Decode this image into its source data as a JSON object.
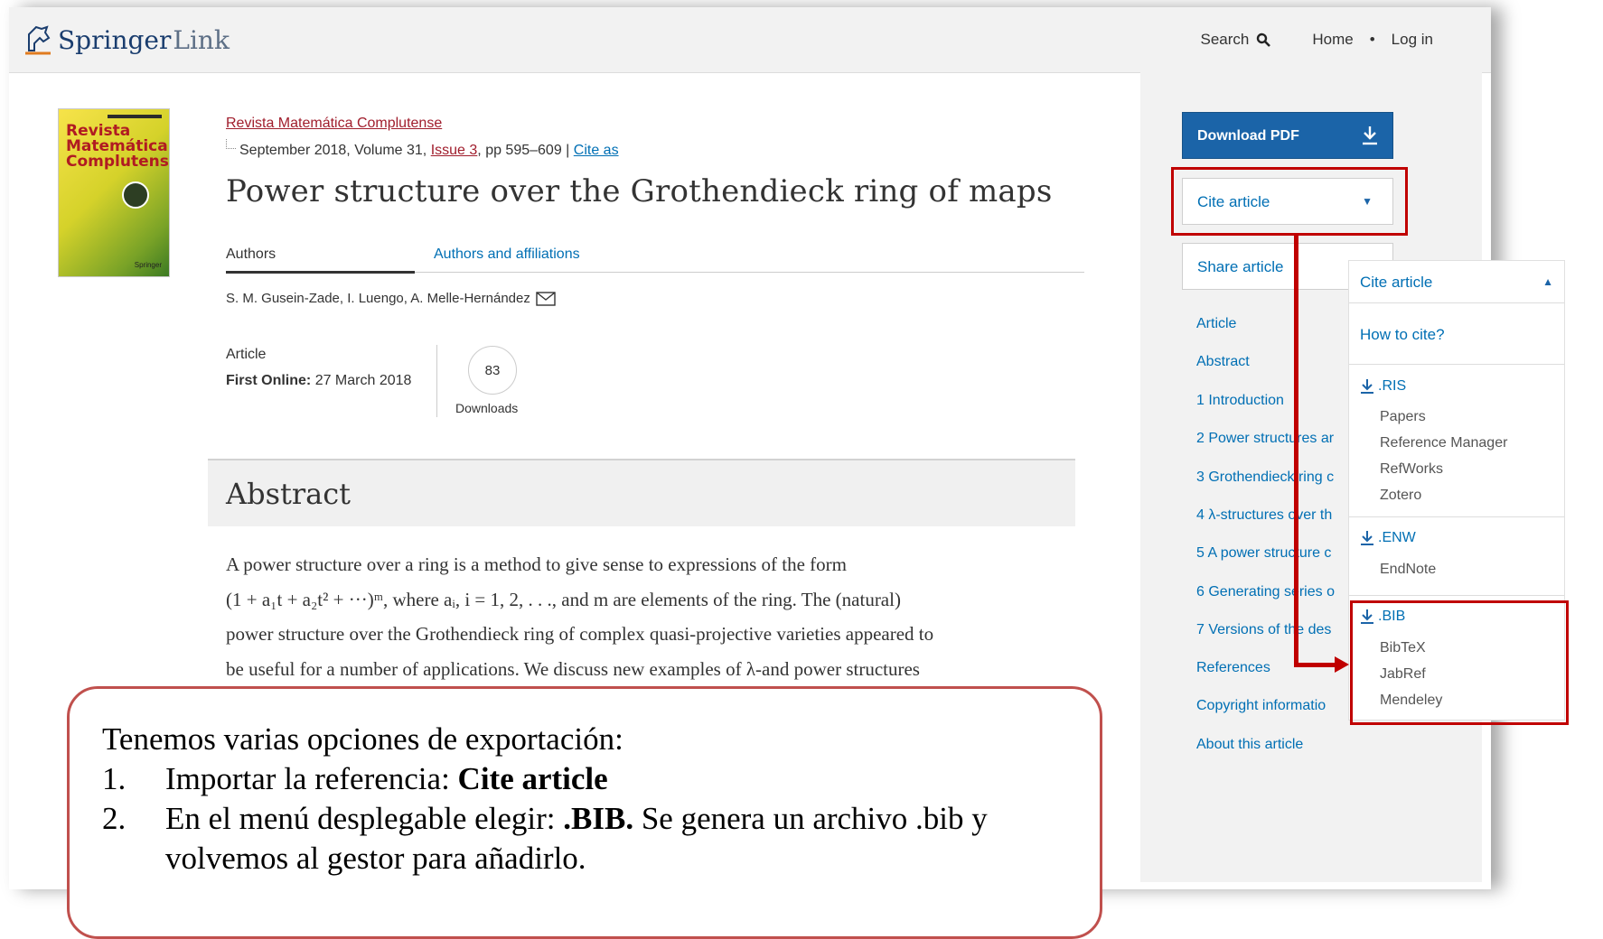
{
  "header": {
    "logo_main": "Springer",
    "logo_light": "Link",
    "nav": {
      "search": "Search",
      "home": "Home",
      "dot": "•",
      "login": "Log in"
    }
  },
  "article": {
    "journal": "Revista Matemática Complutense",
    "meta_prefix": "September 2018, Volume 31, ",
    "issue": "Issue 3",
    "meta_mid": ", pp 595–609 | ",
    "cite_as": "Cite as",
    "title": "Power structure over the Grothendieck ring of maps",
    "tabs": {
      "authors": "Authors",
      "affiliations": "Authors and affiliations"
    },
    "authors": "S. M. Gusein-Zade, I. Luengo, A. Melle-Hernández",
    "type": "Article",
    "first_online_label": "First Online:",
    "first_online_date": "27 March 2018",
    "downloads_count": "83",
    "downloads_label": "Downloads"
  },
  "cover": {
    "title_line1": "Revista",
    "title_line2": "Matemática",
    "title_line3": "Complutense",
    "publisher": "Springer"
  },
  "abstract": {
    "heading": "Abstract",
    "line1": "A power structure over a ring is a method to give sense to expressions of the form",
    "line2": "(1 + a₁t + a₂t² + ···)ᵐ, where aᵢ, i = 1, 2, . . ., and m are elements of the ring. The (natural)",
    "line3": "power structure over the Grothendieck ring of complex quasi-projective varieties appeared to",
    "line4": "be useful for a number of applications. We discuss new examples of λ-and power structures"
  },
  "sidebar": {
    "download_pdf": "Download PDF",
    "cite_article": "Cite article",
    "share_article": "Share article",
    "toc": [
      "Article",
      "Abstract",
      "1 Introduction",
      "2 Power structures ar",
      "3 Grothendieck ring c",
      "4 λ-structures over th",
      "5 A power structure c",
      "6 Generating series o",
      "7 Versions of the des"
    ],
    "toc_tail": [
      "References",
      "Copyright informatio",
      "About this article"
    ]
  },
  "cite_dropdown": {
    "header": "Cite article",
    "how_to_cite": "How to cite?",
    "ris": {
      "label": ".RIS",
      "items": [
        "Papers",
        "Reference Manager",
        "RefWorks",
        "Zotero"
      ]
    },
    "enw": {
      "label": ".ENW",
      "items": [
        "EndNote"
      ]
    },
    "bib": {
      "label": ".BIB",
      "items": [
        "BibTeX",
        "JabRef",
        "Mendeley"
      ]
    }
  },
  "callout": {
    "intro": "Tenemos varias opciones de exportación:",
    "n1": "1.",
    "s1_text": "Importar la referencia: ",
    "s1_bold": "Cite article",
    "n2": "2.",
    "s2_text": "En el menú desplegable elegir: ",
    "s2_bold": ".BIB.",
    "s2_rest": " Se genera un archivo .bib y",
    "s2_line2": "volvemos al gestor para añadirlo."
  },
  "colors": {
    "accent_red": "#c00000",
    "link_blue": "#006fb4",
    "pdf_button": "#1b64a8",
    "journal_link": "#a01d2c"
  }
}
